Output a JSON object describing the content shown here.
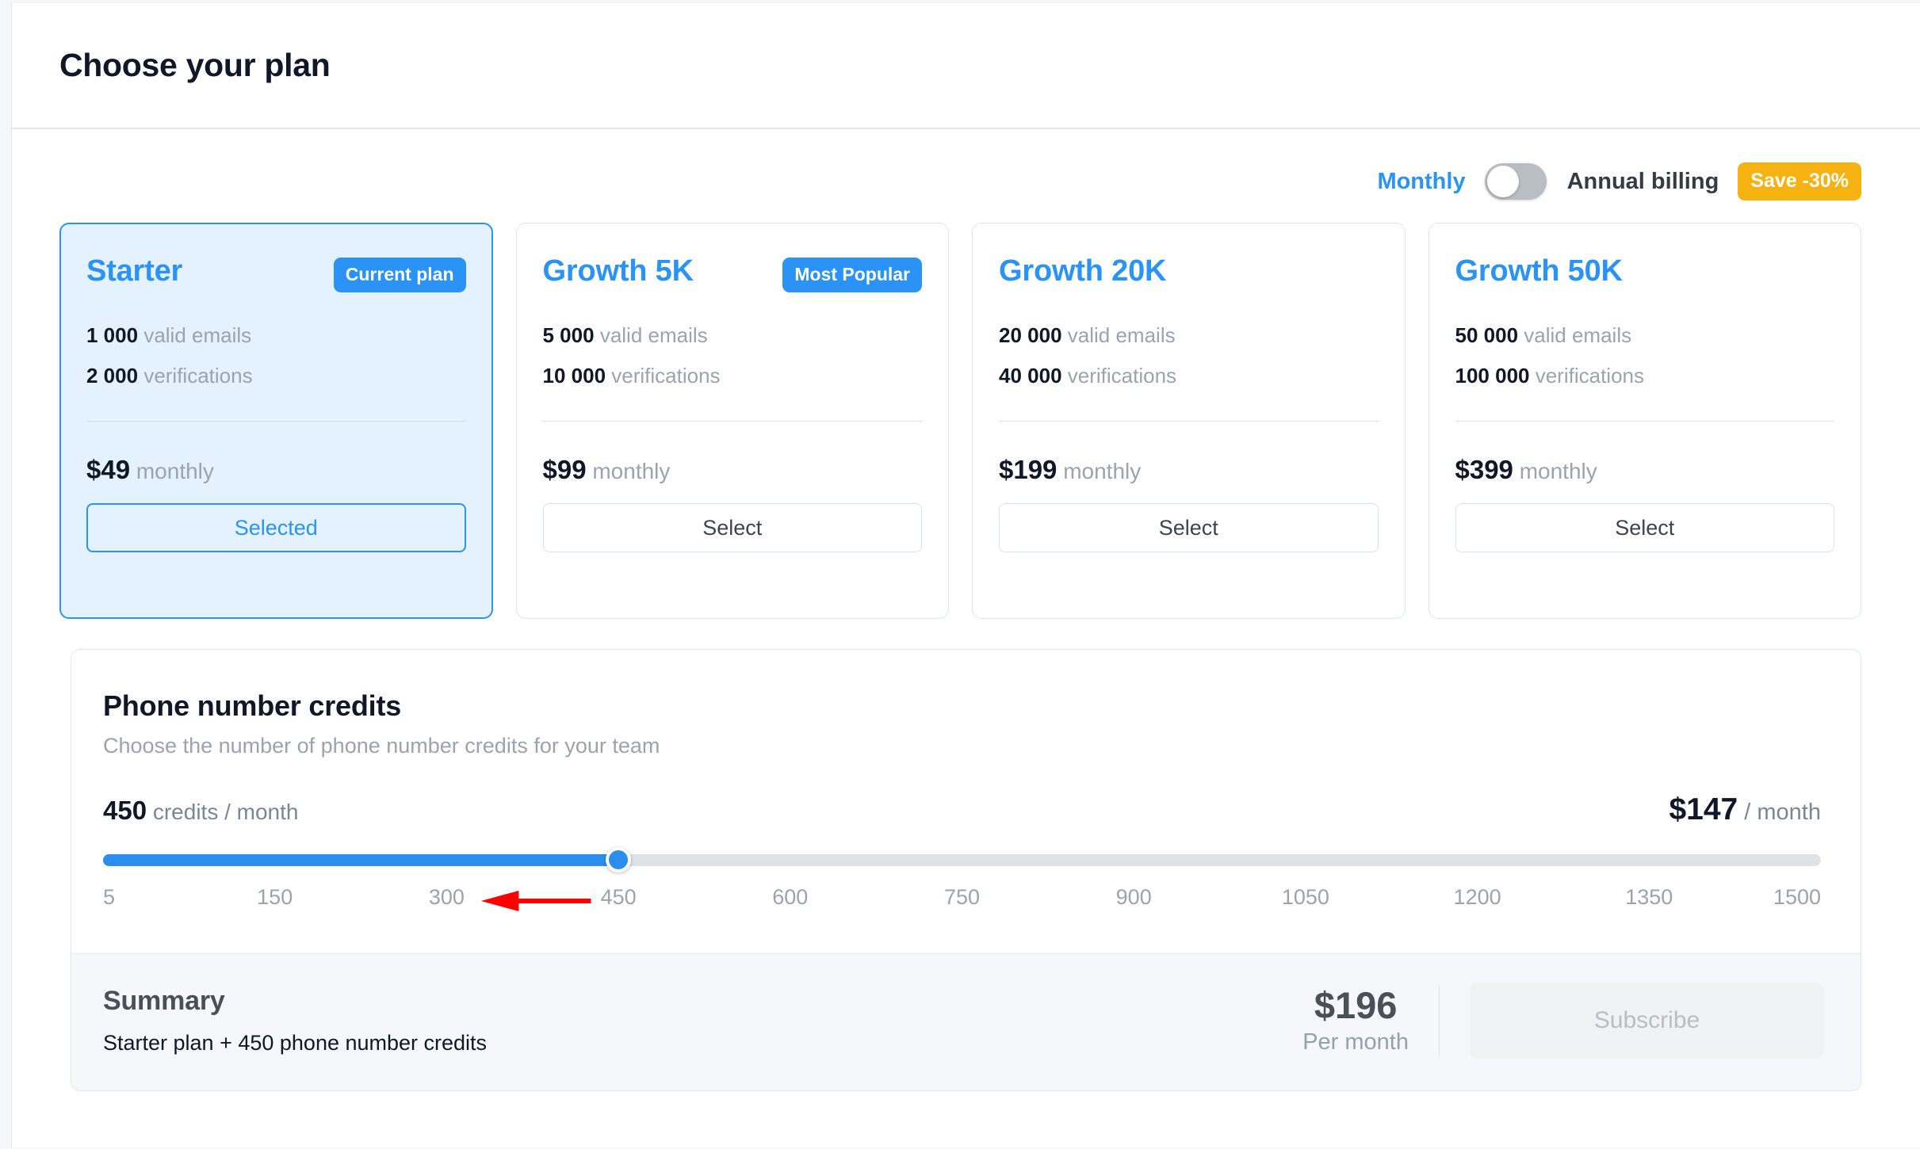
{
  "header": {
    "title": "Choose your plan"
  },
  "billing": {
    "monthly_label": "Monthly",
    "annual_label": "Annual billing",
    "save_badge": "Save -30%",
    "toggle_state": "monthly",
    "accent_color": "#2B93F5",
    "badge_color": "#F5B210"
  },
  "plans": [
    {
      "name": "Starter",
      "badge": "Current plan",
      "emails_value": "1 000",
      "emails_label": "valid emails",
      "verifications_value": "2 000",
      "verifications_label": "verifications",
      "price": "$49",
      "period": "monthly",
      "button": "Selected",
      "selected": true
    },
    {
      "name": "Growth 5K",
      "badge": "Most Popular",
      "emails_value": "5 000",
      "emails_label": "valid emails",
      "verifications_value": "10 000",
      "verifications_label": "verifications",
      "price": "$99",
      "period": "monthly",
      "button": "Select",
      "selected": false
    },
    {
      "name": "Growth 20K",
      "badge": "",
      "emails_value": "20 000",
      "emails_label": "valid emails",
      "verifications_value": "40 000",
      "verifications_label": "verifications",
      "price": "$199",
      "period": "monthly",
      "button": "Select",
      "selected": false
    },
    {
      "name": "Growth 50K",
      "badge": "",
      "emails_value": "50 000",
      "emails_label": "valid emails",
      "verifications_value": "100 000",
      "verifications_label": "verifications",
      "price": "$399",
      "period": "monthly",
      "button": "Select",
      "selected": false
    }
  ],
  "credits": {
    "title": "Phone number credits",
    "subtitle": "Choose the number of phone number credits for your team",
    "amount_value": "450",
    "amount_label": "credits / month",
    "cost_value": "$147",
    "cost_label": "/ month",
    "slider": {
      "value": 450,
      "min": 5,
      "max": 1500,
      "ticks": [
        "5",
        "150",
        "300",
        "450",
        "600",
        "750",
        "900",
        "1050",
        "1200",
        "1350",
        "1500"
      ],
      "fill_color": "#2B8DF0",
      "track_color": "#DFE3E7"
    },
    "annotation": {
      "type": "arrow",
      "color": "#FF0000",
      "from_tick": "450",
      "to_tick": "300"
    }
  },
  "summary": {
    "title": "Summary",
    "description": "Starter plan + 450 phone number credits",
    "price": "$196",
    "period": "Per month",
    "subscribe_label": "Subscribe",
    "subscribe_disabled": true
  }
}
